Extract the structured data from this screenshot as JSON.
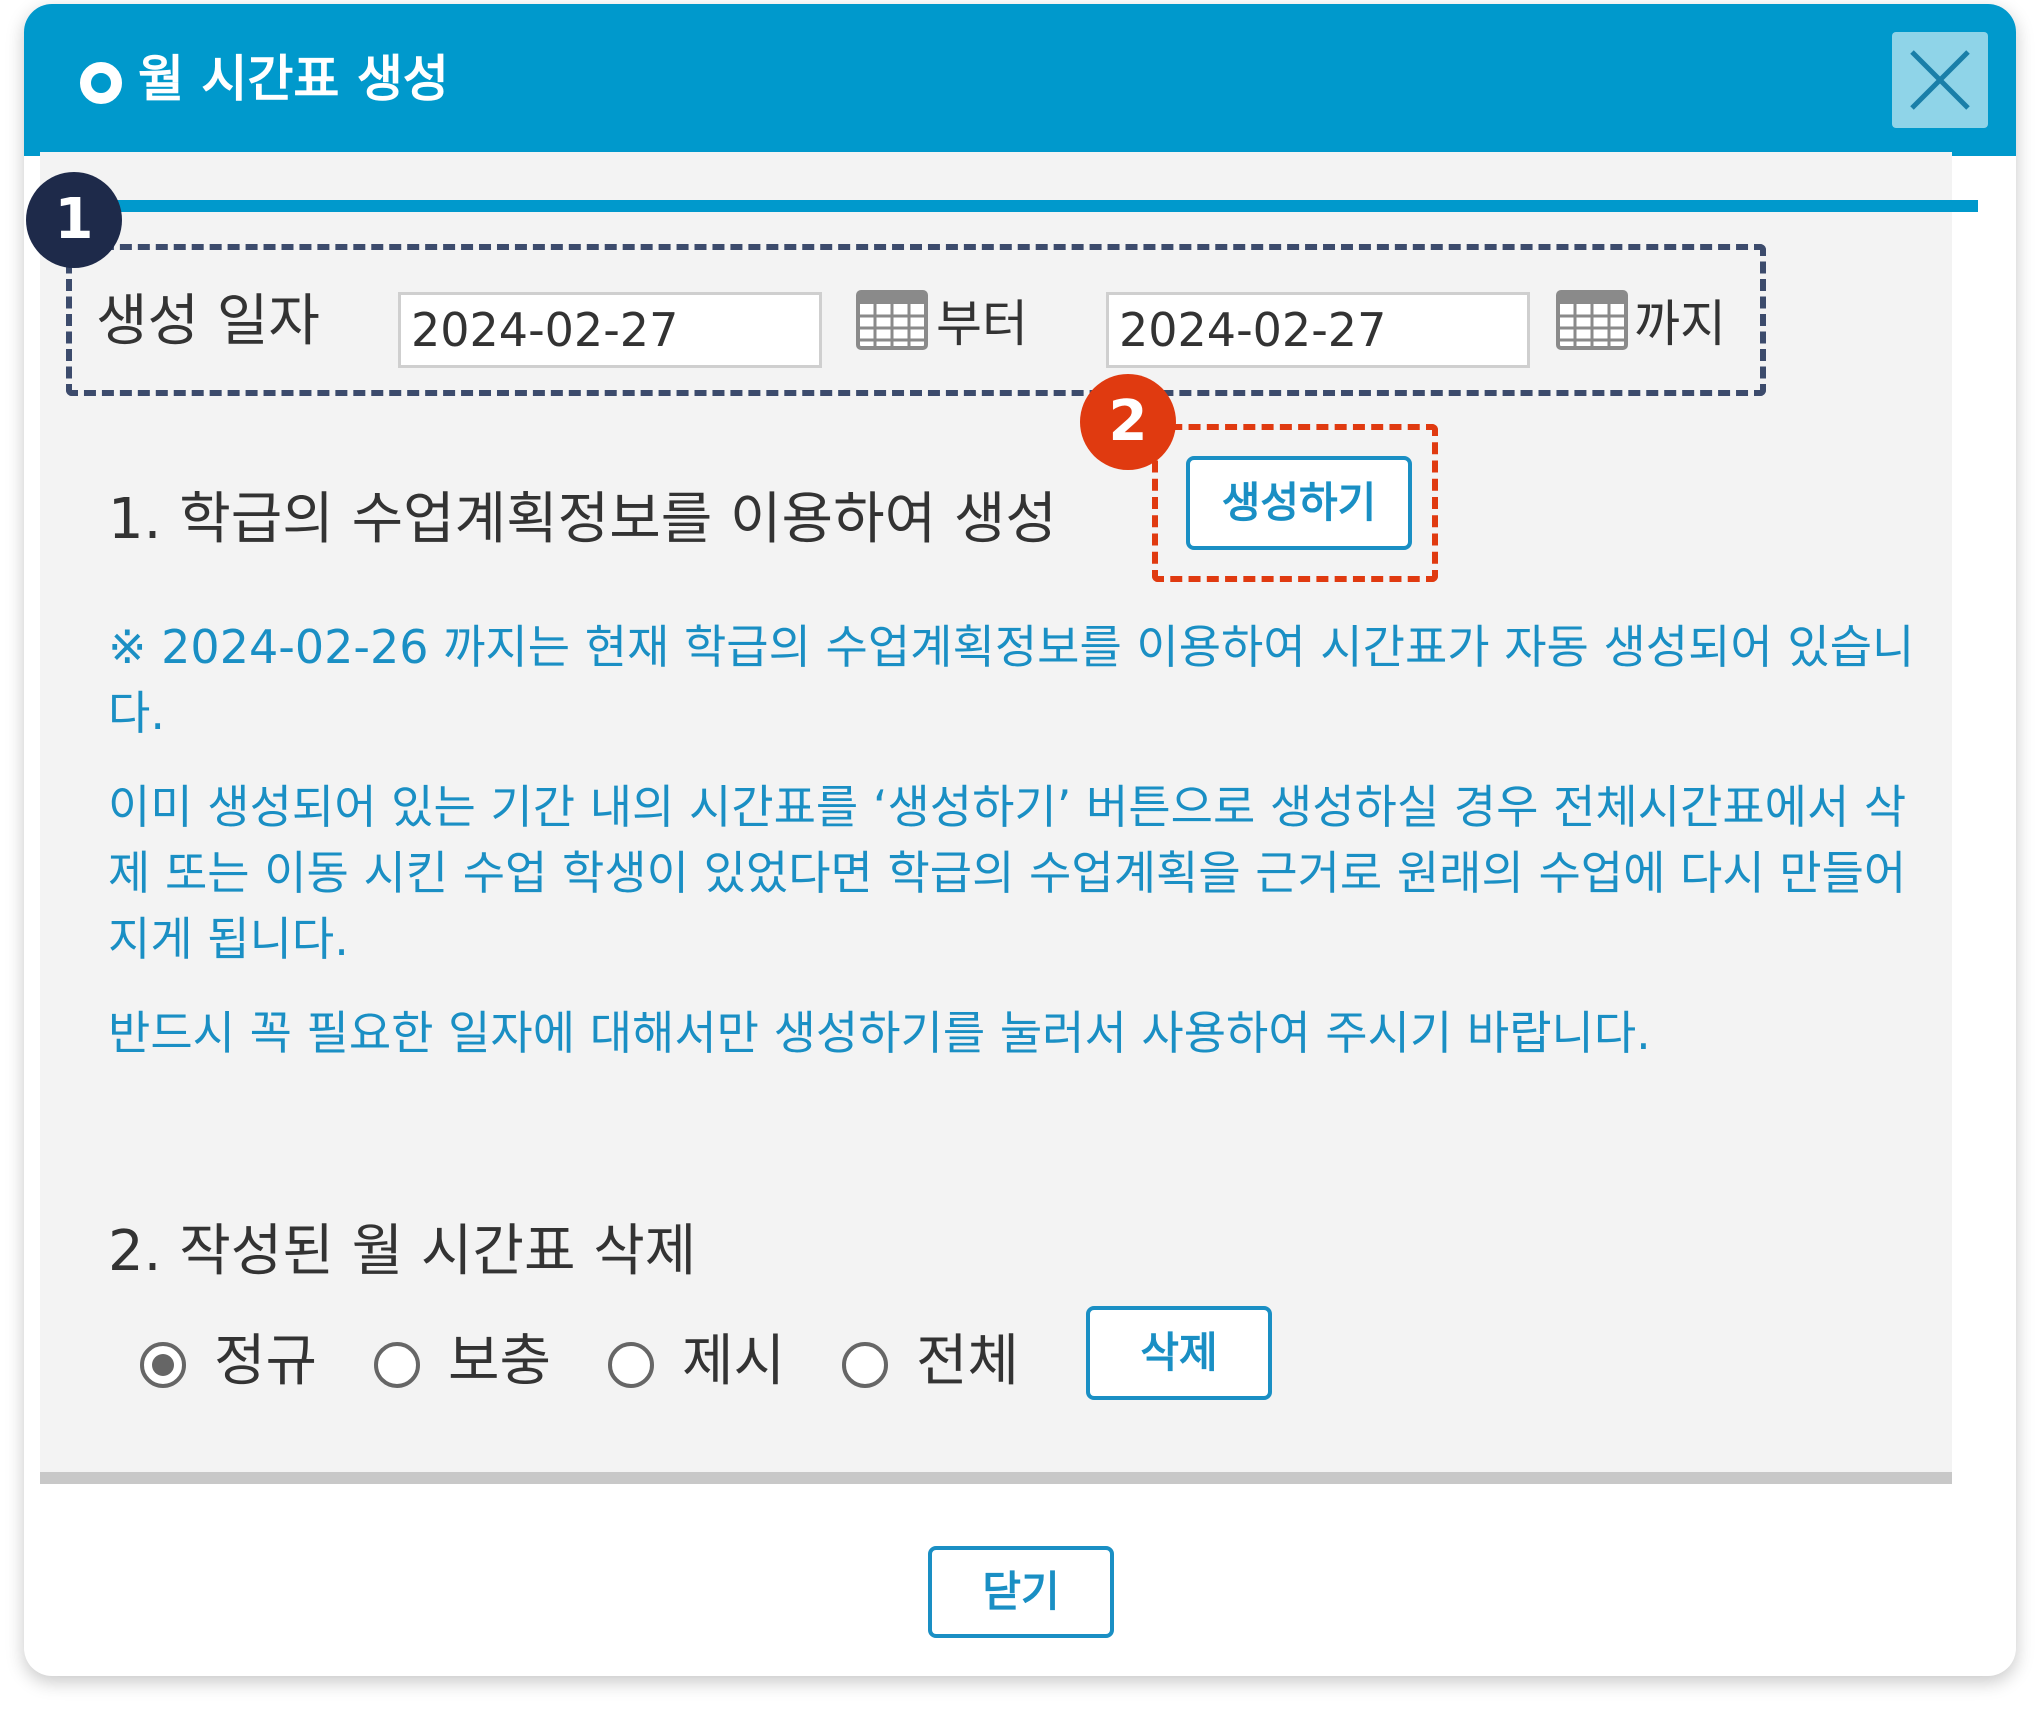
{
  "dialog": {
    "title": "월 시간표 생성",
    "close_icon": "close-icon"
  },
  "badges": {
    "one": "1",
    "two": "2"
  },
  "date_range": {
    "label": "생성 일자",
    "from_value": "2024-02-27",
    "from_suffix": "부터",
    "to_value": "2024-02-27",
    "to_suffix": "까지",
    "calendar_icon": "calendar-icon"
  },
  "section1": {
    "label": "1. 학급의 수업계획정보를 이용하여 생성",
    "button_label": "생성하기"
  },
  "notes": {
    "line1": "※ 2024-02-26 까지는 현재 학급의 수업계획정보를 이용하여 시간표가 자동 생성되어 있습니다.",
    "line2": "이미 생성되어 있는 기간 내의 시간표를 ‘생성하기’ 버튼으로 생성하실 경우 전체시간표에서 삭제 또는 이동 시킨 수업 학생이 있었다면 학급의 수업계획을 근거로 원래의 수업에 다시 만들어 지게 됩니다.",
    "line3": "반드시 꼭 필요한 일자에 대해서만 생성하기를 눌러서 사용하여 주시기 바랍니다."
  },
  "section2": {
    "label": "2. 작성된 월 시간표 삭제",
    "radio_options": [
      "정규",
      "보충",
      "제시",
      "전체"
    ],
    "selected": "정규",
    "delete_label": "삭제"
  },
  "footer": {
    "close_label": "닫기"
  },
  "colors": {
    "titlebar": "#0099cc",
    "accent_text": "#1a8fc4",
    "badge_dark": "#1e2a4a",
    "badge_red": "#e03a10"
  }
}
